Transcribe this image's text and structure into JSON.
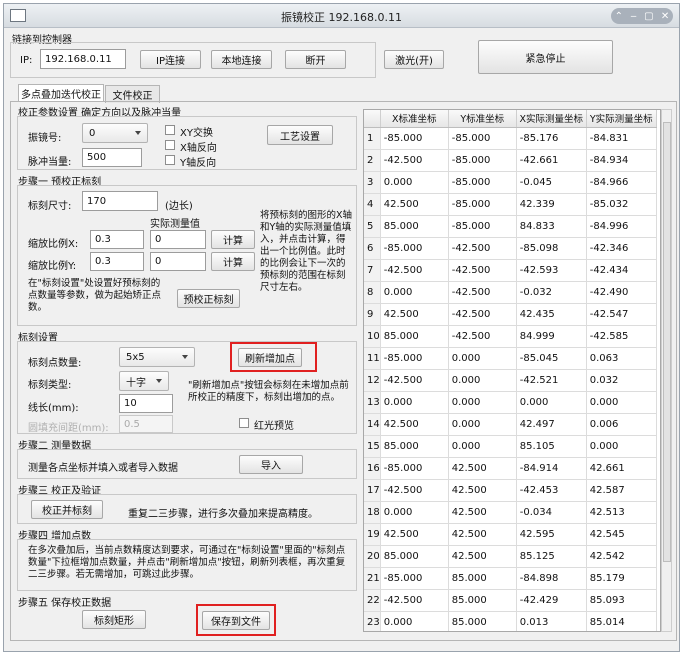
{
  "window": {
    "title": "振镜校正 192.168.0.11"
  },
  "connection": {
    "group_label": "链接到控制器",
    "ip_label": "IP:",
    "ip_value": "192.168.0.11",
    "ip_connect": "IP连接",
    "local_connect": "本地连接",
    "disconnect": "断开",
    "laser": "激光(开)",
    "emergency": "紧急停止"
  },
  "tabs": [
    "多点叠加迭代校正",
    "文件校正"
  ],
  "params": {
    "title": "校正参数设置 确定方向以及脉冲当量",
    "galvo_label": "振镜号:",
    "galvo_value": "0",
    "pulse_label": "脉冲当量:",
    "pulse_value": "500",
    "xy_swap": "XY交换",
    "x_reverse": "X轴反向",
    "y_reverse": "Y轴反向",
    "process_settings": "工艺设置"
  },
  "step1": {
    "title": "步骤一 预校正标刻",
    "size_label": "标刻尺寸:",
    "size_value": "170",
    "size_unit": "(边长)",
    "measured_header": "实际测量值",
    "scale_x_label": "缩放比例X:",
    "scale_x_value": "0.3",
    "measured_x_value": "0",
    "scale_y_label": "缩放比例Y:",
    "scale_y_value": "0.3",
    "measured_y_value": "0",
    "calc": "计算",
    "help": "将预标刻的图形的X轴和Y轴的实际测量值填入，并点击计算，得出一个比例值。此时的比例会让下一次的预标刻的范围在标刻尺寸左右。",
    "note": "在\"标刻设置\"处设置好预标刻的点数量等参数，做为起始矫正点数。",
    "pre_mark": "预校正标刻"
  },
  "mark_settings": {
    "title": "标刻设置",
    "points_label": "标刻点数量:",
    "points_value": "5x5",
    "refresh": "刷新增加点",
    "type_label": "标刻类型:",
    "type_value": "十字",
    "length_label": "线长(mm):",
    "length_value": "10",
    "fill_label": "圆填充间距(mm):",
    "fill_value": "0.5",
    "hint": "\"刷新增加点\"按钮会标刻在未增加点前所校正的精度下，标刻出增加的点。",
    "red_preview": "红光预览"
  },
  "step2": {
    "title": "步骤二 测量数据",
    "text": "测量各点坐标并填入或者导入数据",
    "import": "导入"
  },
  "step3": {
    "title": "步骤三 校正及验证",
    "button": "校正并标刻",
    "text": "重复二三步骤，进行多次叠加来提高精度。"
  },
  "step4": {
    "title": "步骤四 增加点数",
    "text": "在多次叠加后，当前点数精度达到要求，可通过在\"标刻设置\"里面的\"标刻点数量\"下拉框增加点数量，并点击\"刷新增加点\"按钮，刷新列表框，再次重复二三步骤。若无需增加，可跳过此步骤。"
  },
  "step5": {
    "title": "步骤五 保存校正数据",
    "mark_rect": "标刻矩形",
    "save": "保存到文件"
  },
  "table": {
    "headers": [
      "X标准坐标",
      "Y标准坐标",
      "X实际测量坐标",
      "Y实际测量坐标"
    ],
    "rows": [
      [
        "1",
        "-85.000",
        "-85.000",
        "-85.176",
        "-84.831"
      ],
      [
        "2",
        "-42.500",
        "-85.000",
        "-42.661",
        "-84.934"
      ],
      [
        "3",
        "0.000",
        "-85.000",
        "-0.045",
        "-84.966"
      ],
      [
        "4",
        "42.500",
        "-85.000",
        "42.339",
        "-85.032"
      ],
      [
        "5",
        "85.000",
        "-85.000",
        "84.833",
        "-84.996"
      ],
      [
        "6",
        "-85.000",
        "-42.500",
        "-85.098",
        "-42.346"
      ],
      [
        "7",
        "-42.500",
        "-42.500",
        "-42.593",
        "-42.434"
      ],
      [
        "8",
        "0.000",
        "-42.500",
        "-0.032",
        "-42.490"
      ],
      [
        "9",
        "42.500",
        "-42.500",
        "42.435",
        "-42.547"
      ],
      [
        "10",
        "85.000",
        "-42.500",
        "84.999",
        "-42.585"
      ],
      [
        "11",
        "-85.000",
        "0.000",
        "-85.045",
        "0.063"
      ],
      [
        "12",
        "-42.500",
        "0.000",
        "-42.521",
        "0.032"
      ],
      [
        "13",
        "0.000",
        "0.000",
        "0.000",
        "0.000"
      ],
      [
        "14",
        "42.500",
        "0.000",
        "42.497",
        "0.006"
      ],
      [
        "15",
        "85.000",
        "0.000",
        "85.105",
        "0.000"
      ],
      [
        "16",
        "-85.000",
        "42.500",
        "-84.914",
        "42.661"
      ],
      [
        "17",
        "-42.500",
        "42.500",
        "-42.453",
        "42.587"
      ],
      [
        "18",
        "0.000",
        "42.500",
        "-0.034",
        "42.513"
      ],
      [
        "19",
        "42.500",
        "42.500",
        "42.595",
        "42.545"
      ],
      [
        "20",
        "85.000",
        "42.500",
        "85.125",
        "42.542"
      ],
      [
        "21",
        "-85.000",
        "85.000",
        "-84.898",
        "85.179"
      ],
      [
        "22",
        "-42.500",
        "85.000",
        "-42.429",
        "85.093"
      ],
      [
        "23",
        "0.000",
        "85.000",
        "0.013",
        "85.014"
      ]
    ]
  }
}
